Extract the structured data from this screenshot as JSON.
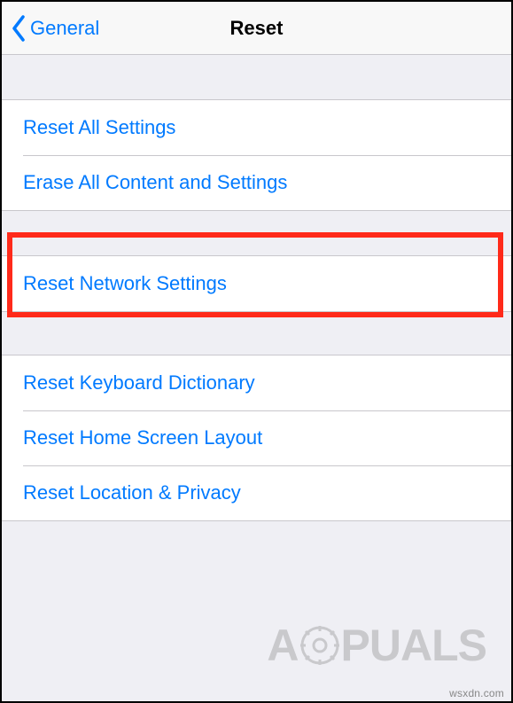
{
  "nav": {
    "back_label": "General",
    "title": "Reset"
  },
  "groups": [
    {
      "items": [
        {
          "label": "Reset All Settings"
        },
        {
          "label": "Erase All Content and Settings"
        }
      ]
    },
    {
      "items": [
        {
          "label": "Reset Network Settings"
        }
      ]
    },
    {
      "items": [
        {
          "label": "Reset Keyboard Dictionary"
        },
        {
          "label": "Reset Home Screen Layout"
        },
        {
          "label": "Reset Location & Privacy"
        }
      ]
    }
  ],
  "watermark": {
    "prefix": "A",
    "suffix": "PUALS"
  },
  "credit": "wsxdn.com"
}
